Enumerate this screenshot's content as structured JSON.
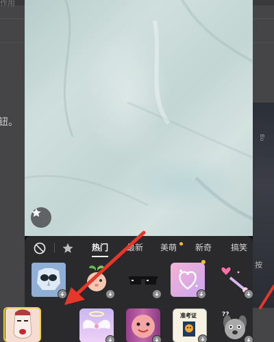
{
  "background": {
    "top_text": "作用",
    "left_text": "钮。",
    "right_text": "按",
    "right_small": "Bo"
  },
  "camera": {
    "favorite_icon": "star-icon"
  },
  "effects_panel": {
    "none_icon": "ban-icon",
    "favorites_icon": "star-icon",
    "tabs": [
      {
        "label": "热门",
        "active": true
      },
      {
        "label": "最新",
        "active": false
      },
      {
        "label": "美萌",
        "active": false,
        "dot": true
      },
      {
        "label": "新奇",
        "active": false
      },
      {
        "label": "搞笑",
        "active": false
      }
    ],
    "row1": [
      {
        "name": "ghost-mask-sticker",
        "download": true
      },
      {
        "name": "peach-sprout-sticker",
        "download": true
      },
      {
        "name": "pixel-sunglasses-sticker",
        "download": true
      },
      {
        "name": "hearts-sticker",
        "download": true,
        "new": true
      },
      {
        "name": "magic-wand-sticker",
        "download": true
      }
    ],
    "row2": [
      {
        "name": "kabuki-mask-sticker",
        "selected": true,
        "download": false
      },
      {
        "name": "angel-wings-sticker",
        "download": true
      },
      {
        "name": "pink-face-sticker",
        "download": true
      },
      {
        "name": "exam-card-sticker",
        "label": "准考证",
        "download": true
      },
      {
        "name": "question-dog-sticker",
        "label": "??",
        "download": true
      }
    ]
  },
  "colors": {
    "selected_border": "#f2d32a",
    "arrow": "#e8362a",
    "panel_bg": "#2a2a2c"
  }
}
